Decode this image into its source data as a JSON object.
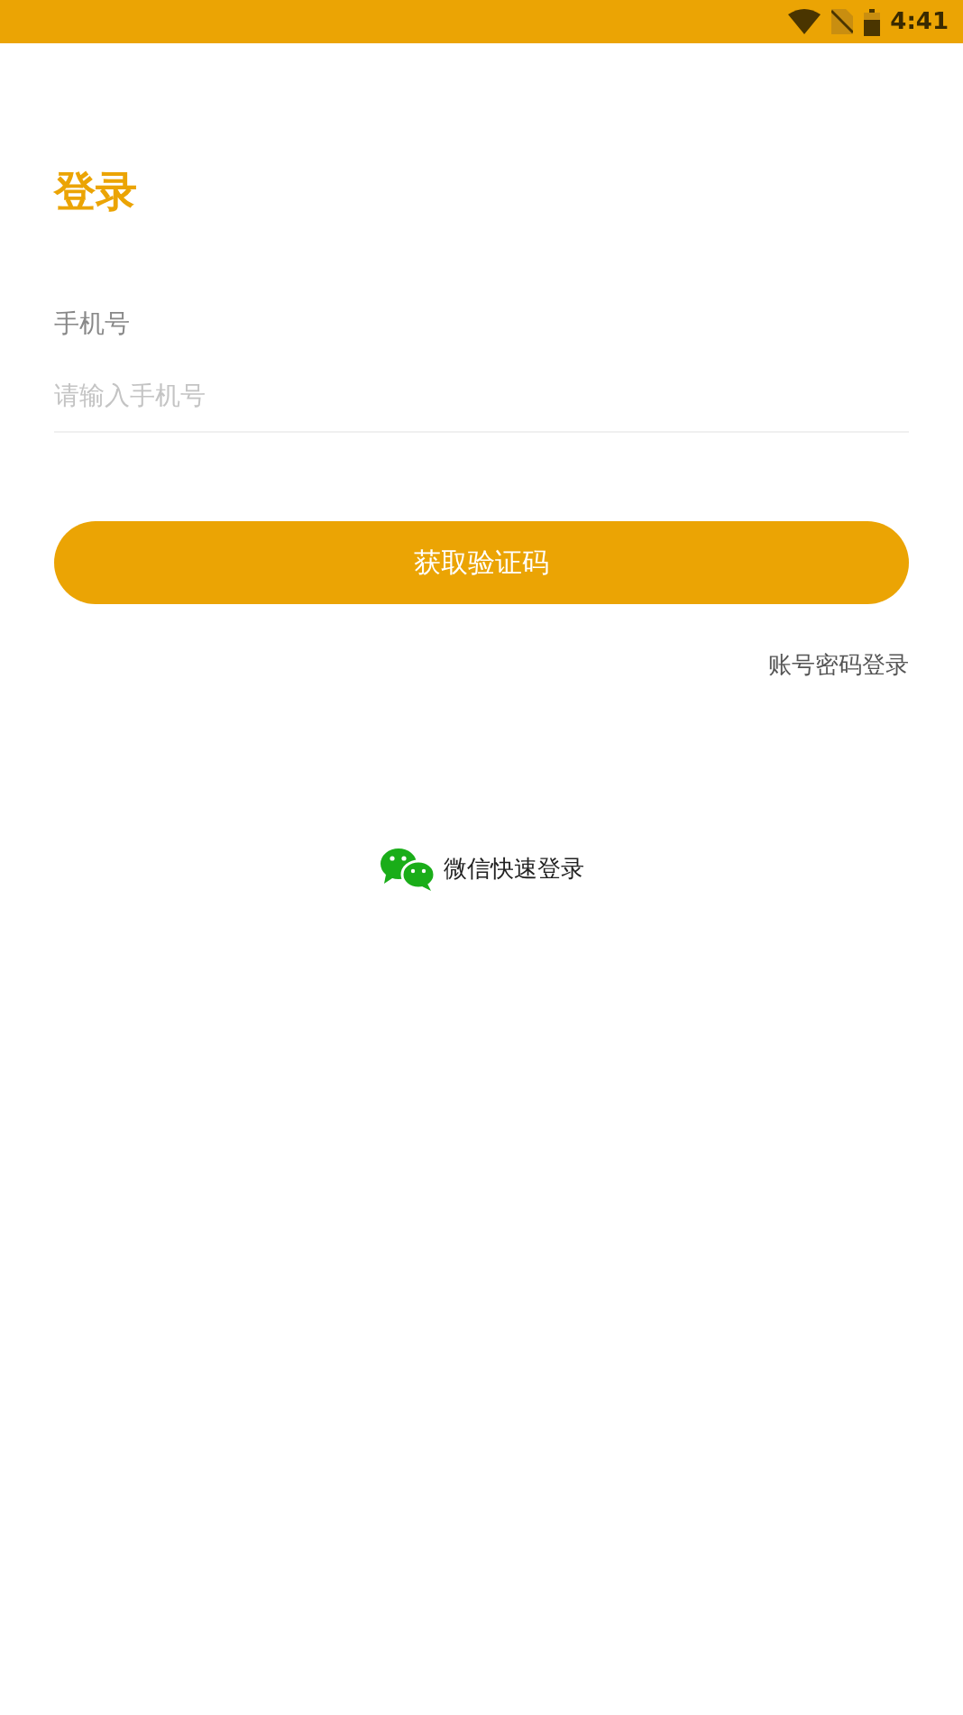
{
  "status_bar": {
    "time": "4:41"
  },
  "title": "登录",
  "phone_field": {
    "label": "手机号",
    "placeholder": "请输入手机号"
  },
  "submit_button": "获取验证码",
  "password_login_link": "账号密码登录",
  "wechat_login": "微信快速登录"
}
